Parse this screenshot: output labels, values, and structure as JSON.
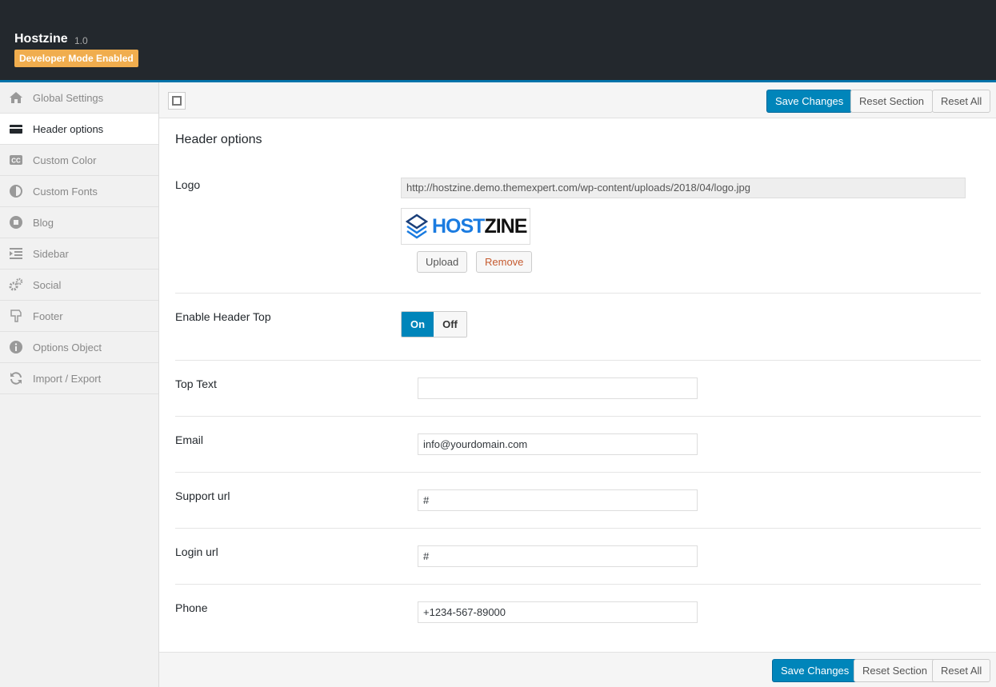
{
  "header": {
    "brand": "Hostzine",
    "version": "1.0",
    "badge": "Developer Mode Enabled"
  },
  "sidebar": {
    "items": [
      {
        "label": "Global Settings",
        "icon": "home-icon"
      },
      {
        "label": "Header options",
        "icon": "credit-card-icon",
        "active": true
      },
      {
        "label": "Custom Color",
        "icon": "cc-icon"
      },
      {
        "label": "Custom Fonts",
        "icon": "contrast-icon"
      },
      {
        "label": "Blog",
        "icon": "circle-square-icon"
      },
      {
        "label": "Sidebar",
        "icon": "indent-icon"
      },
      {
        "label": "Social",
        "icon": "gears-icon"
      },
      {
        "label": "Footer",
        "icon": "hand-down-icon"
      },
      {
        "label": "Options Object",
        "icon": "info-icon"
      },
      {
        "label": "Import / Export",
        "icon": "refresh-icon"
      }
    ]
  },
  "toolbar": {
    "save": "Save Changes",
    "reset_section": "Reset Section",
    "reset_all": "Reset All"
  },
  "section": {
    "title": "Header options"
  },
  "fields": {
    "logo": {
      "label": "Logo",
      "url": "http://hostzine.demo.themexpert.com/wp-content/uploads/2018/04/logo.jpg",
      "preview_host": "HOST",
      "preview_zine": "ZINE",
      "upload": "Upload",
      "remove": "Remove"
    },
    "header_top": {
      "label": "Enable Header Top",
      "on": "On",
      "off": "Off",
      "value": "On"
    },
    "top_text": {
      "label": "Top Text",
      "value": ""
    },
    "email": {
      "label": "Email",
      "value": "info@yourdomain.com"
    },
    "support_url": {
      "label": "Support url",
      "value": "#"
    },
    "login_url": {
      "label": "Login url",
      "value": "#"
    },
    "phone": {
      "label": "Phone",
      "value": "+1234-567-89000"
    }
  },
  "colors": {
    "accent": "#0085ba",
    "header_bg": "#23282d",
    "badge": "#f0ad4e",
    "remove_text": "#c65b30"
  }
}
